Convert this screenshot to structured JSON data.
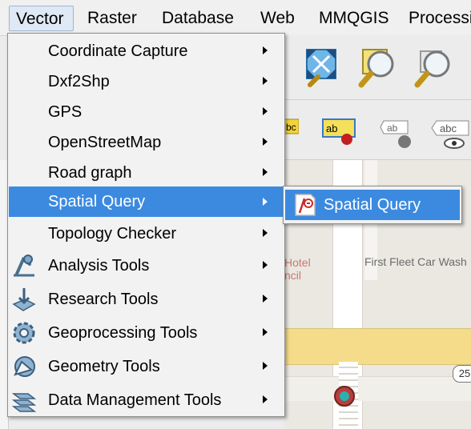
{
  "menubar": {
    "items": [
      {
        "label": "Vector"
      },
      {
        "label": "Raster"
      },
      {
        "label": "Database"
      },
      {
        "label": "Web"
      },
      {
        "label": "MMQGIS"
      },
      {
        "label": "Processing"
      }
    ]
  },
  "vector_menu": {
    "items": [
      {
        "label": "Coordinate Capture",
        "submenu": true
      },
      {
        "label": "Dxf2Shp",
        "submenu": true
      },
      {
        "label": "GPS",
        "submenu": true
      },
      {
        "label": "OpenStreetMap",
        "submenu": true
      },
      {
        "label": "Road graph",
        "submenu": true
      },
      {
        "label": "Spatial Query",
        "submenu": true,
        "highlighted": true
      },
      {
        "label": "Topology Checker",
        "submenu": true
      },
      {
        "label": "Analysis Tools",
        "icon": "analysis-tools-icon",
        "submenu": true
      },
      {
        "label": "Research Tools",
        "icon": "research-tools-icon",
        "submenu": true
      },
      {
        "label": "Geoprocessing Tools",
        "icon": "geoprocessing-tools-icon",
        "submenu": true
      },
      {
        "label": "Geometry Tools",
        "icon": "geometry-tools-icon",
        "submenu": true
      },
      {
        "label": "Data Management Tools",
        "icon": "data-management-tools-icon",
        "submenu": true
      }
    ]
  },
  "spatial_query_submenu": {
    "items": [
      {
        "label": "Spatial Query",
        "icon": "spatial-query-icon",
        "highlighted": true
      }
    ]
  },
  "toolbar": {
    "label_icons": [
      "bc",
      "ab",
      "ab",
      "abc"
    ]
  },
  "map": {
    "labels": [
      "Hotel",
      "ncil",
      "First Fleet Car Wash"
    ],
    "road_shield": "25"
  },
  "colors": {
    "highlight": "#3b8ae0",
    "menu_background": "#f2f2f2",
    "map_road_major": "#f5dc8a"
  }
}
